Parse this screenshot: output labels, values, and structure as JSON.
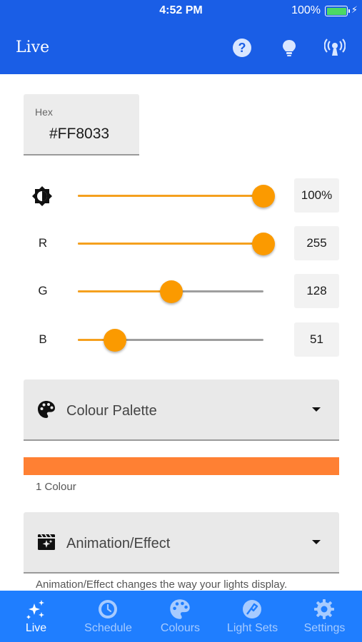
{
  "status_bar": {
    "time": "4:52 PM",
    "battery_percent": "100%",
    "battery_level": 1.0
  },
  "app_bar": {
    "title": "Live",
    "icons": [
      "help-icon",
      "bulb-icon",
      "broadcast-icon"
    ]
  },
  "hex_field": {
    "label": "Hex",
    "value": "#FF8033"
  },
  "sliders": [
    {
      "name": "brightness",
      "icon": "brightness-icon",
      "label": "",
      "value_text": "100%",
      "value": 100,
      "max": 100
    },
    {
      "name": "red",
      "label": "R",
      "value_text": "255",
      "value": 255,
      "max": 255
    },
    {
      "name": "green",
      "label": "G",
      "value_text": "128",
      "value": 128,
      "max": 255
    },
    {
      "name": "blue",
      "label": "B",
      "value_text": "51",
      "value": 51,
      "max": 255
    }
  ],
  "colour_palette": {
    "label": "Colour Palette",
    "icon": "palette-icon",
    "selected_colour": "#ff8033",
    "count_text": "1 Colour"
  },
  "animation_effect": {
    "label": "Animation/Effect",
    "icon": "clapperboard-sparkle-icon",
    "helper_text": "Animation/Effect changes the way your lights display."
  },
  "tab_bar": {
    "active_index": 0,
    "tabs": [
      {
        "label": "Live",
        "icon": "sparkles-icon"
      },
      {
        "label": "Schedule",
        "icon": "schedule-clock-icon"
      },
      {
        "label": "Colours",
        "icon": "palette-icon"
      },
      {
        "label": "Light Sets",
        "icon": "light-sets-icon"
      },
      {
        "label": "Settings",
        "icon": "gear-icon"
      }
    ]
  },
  "colors": {
    "primary": "#1a5ee6",
    "tab_bar": "#1f7eff",
    "accent": "#fb9a00",
    "track_inactive": "#9e9e9e"
  }
}
